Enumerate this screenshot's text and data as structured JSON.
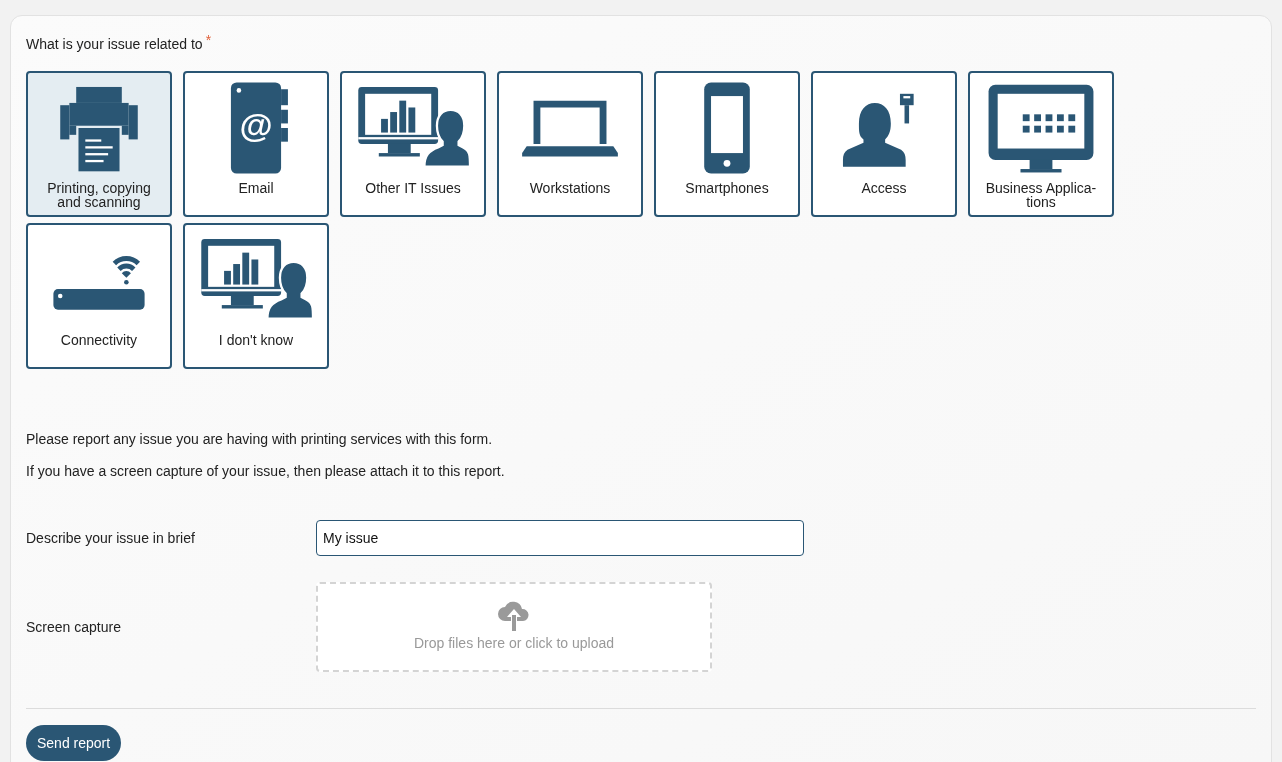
{
  "question": {
    "label": "What is your issue related to",
    "required_mark": "*"
  },
  "categories": [
    {
      "label": "Printing, copying and scanning",
      "kind": "printer",
      "selected": true
    },
    {
      "label": "Email",
      "kind": "email",
      "icon_text": "@",
      "selected": false
    },
    {
      "label": "Other IT Issues",
      "kind": "support",
      "selected": false
    },
    {
      "label": "Workstations",
      "kind": "laptop",
      "selected": false
    },
    {
      "label": "Smartphones",
      "kind": "phone",
      "selected": false
    },
    {
      "label": "Access",
      "kind": "access",
      "selected": false
    },
    {
      "label": "Business Applica-tions",
      "kind": "monitor",
      "selected": false
    },
    {
      "label": "Connectivity",
      "kind": "router",
      "selected": false
    },
    {
      "label": "I don't know",
      "kind": "support",
      "selected": false
    }
  ],
  "instructions": [
    "Please report any issue you are having with printing services with this form.",
    "If you have a screen capture of your issue, then please attach it to this report."
  ],
  "fields": [
    {
      "kind": "text",
      "label": "Describe your issue in brief",
      "value": "My issue"
    },
    {
      "kind": "upload",
      "label": "Screen capture",
      "prompt": "Drop files here or click to upload"
    }
  ],
  "submit": "Send report"
}
